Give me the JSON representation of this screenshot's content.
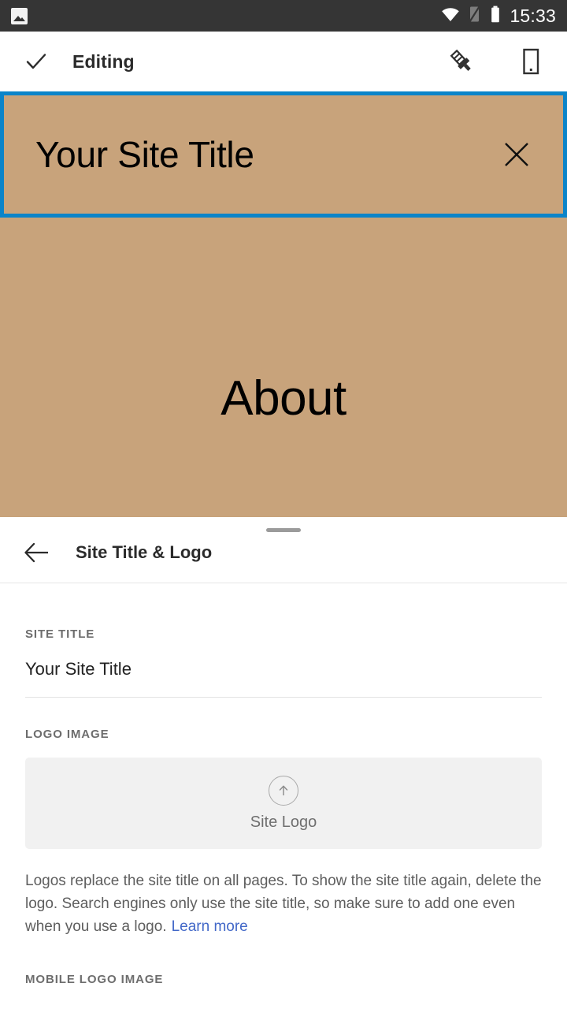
{
  "status_bar": {
    "notification_icon": "photo-icon",
    "wifi_icon": "wifi-icon",
    "signal_icon": "signal-off-icon",
    "battery_icon": "battery-icon",
    "time": "15:33",
    "background_color": "#353535"
  },
  "app_bar": {
    "done_icon": "check-icon",
    "title": "Editing",
    "customize_icon": "paintbrush-icon",
    "preview_icon": "mobile-device-icon"
  },
  "preview": {
    "background_color": "#c8a37b",
    "selection_border_color": "#0b84c9",
    "selected_block": {
      "site_title": "Your Site Title",
      "close_icon": "close-icon"
    },
    "page_heading": "About"
  },
  "sheet": {
    "back_icon": "back-arrow-icon",
    "title": "Site Title & Logo",
    "site_title_field": {
      "label": "SITE TITLE",
      "value": "Your Site Title",
      "placeholder": "Your Site Title"
    },
    "logo_image_field": {
      "label": "LOGO IMAGE",
      "upload_icon": "upload-arrow-icon",
      "drop_label": "Site Logo"
    },
    "help_text": "Logos replace the site title on all pages. To show the site title again, delete the logo. Search engines only use the site title, so make sure to add one even when you use a logo.",
    "learn_more_label": "Learn more",
    "learn_more_color": "#4268c8",
    "mobile_logo_field": {
      "label": "MOBILE LOGO IMAGE"
    }
  }
}
